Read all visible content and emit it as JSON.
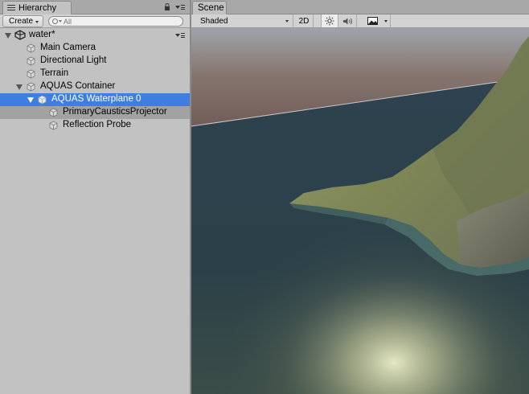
{
  "hierarchy": {
    "tab_label": "Hierarchy",
    "create_label": "Create",
    "search_placeholder": "All",
    "scene_name": "water*",
    "items": [
      {
        "label": "Main Camera"
      },
      {
        "label": "Directional Light"
      },
      {
        "label": "Terrain"
      },
      {
        "label": "AQUAS Container"
      },
      {
        "label": "AQUAS Waterplane 0"
      },
      {
        "label": "PrimaryCausticsProjector"
      },
      {
        "label": "Reflection Probe"
      }
    ]
  },
  "scene": {
    "tab_label": "Scene",
    "shading_mode": "Shaded",
    "mode_2d_label": "2D"
  },
  "icons": {
    "hierarchy_tab": "list-icon",
    "lock": "lock-icon",
    "panel_menu": "menu-icon",
    "search": "search-icon",
    "scene_root": "unity-logo-icon",
    "game_object": "cube-icon",
    "lighting_toggle": "sun-icon",
    "audio_toggle": "speaker-icon",
    "effects_toggle": "image-icon"
  },
  "colors": {
    "selection": "#3d7ee0",
    "panel_bg": "#c2c2c2",
    "toolbar_bg": "#d2d2d2"
  }
}
